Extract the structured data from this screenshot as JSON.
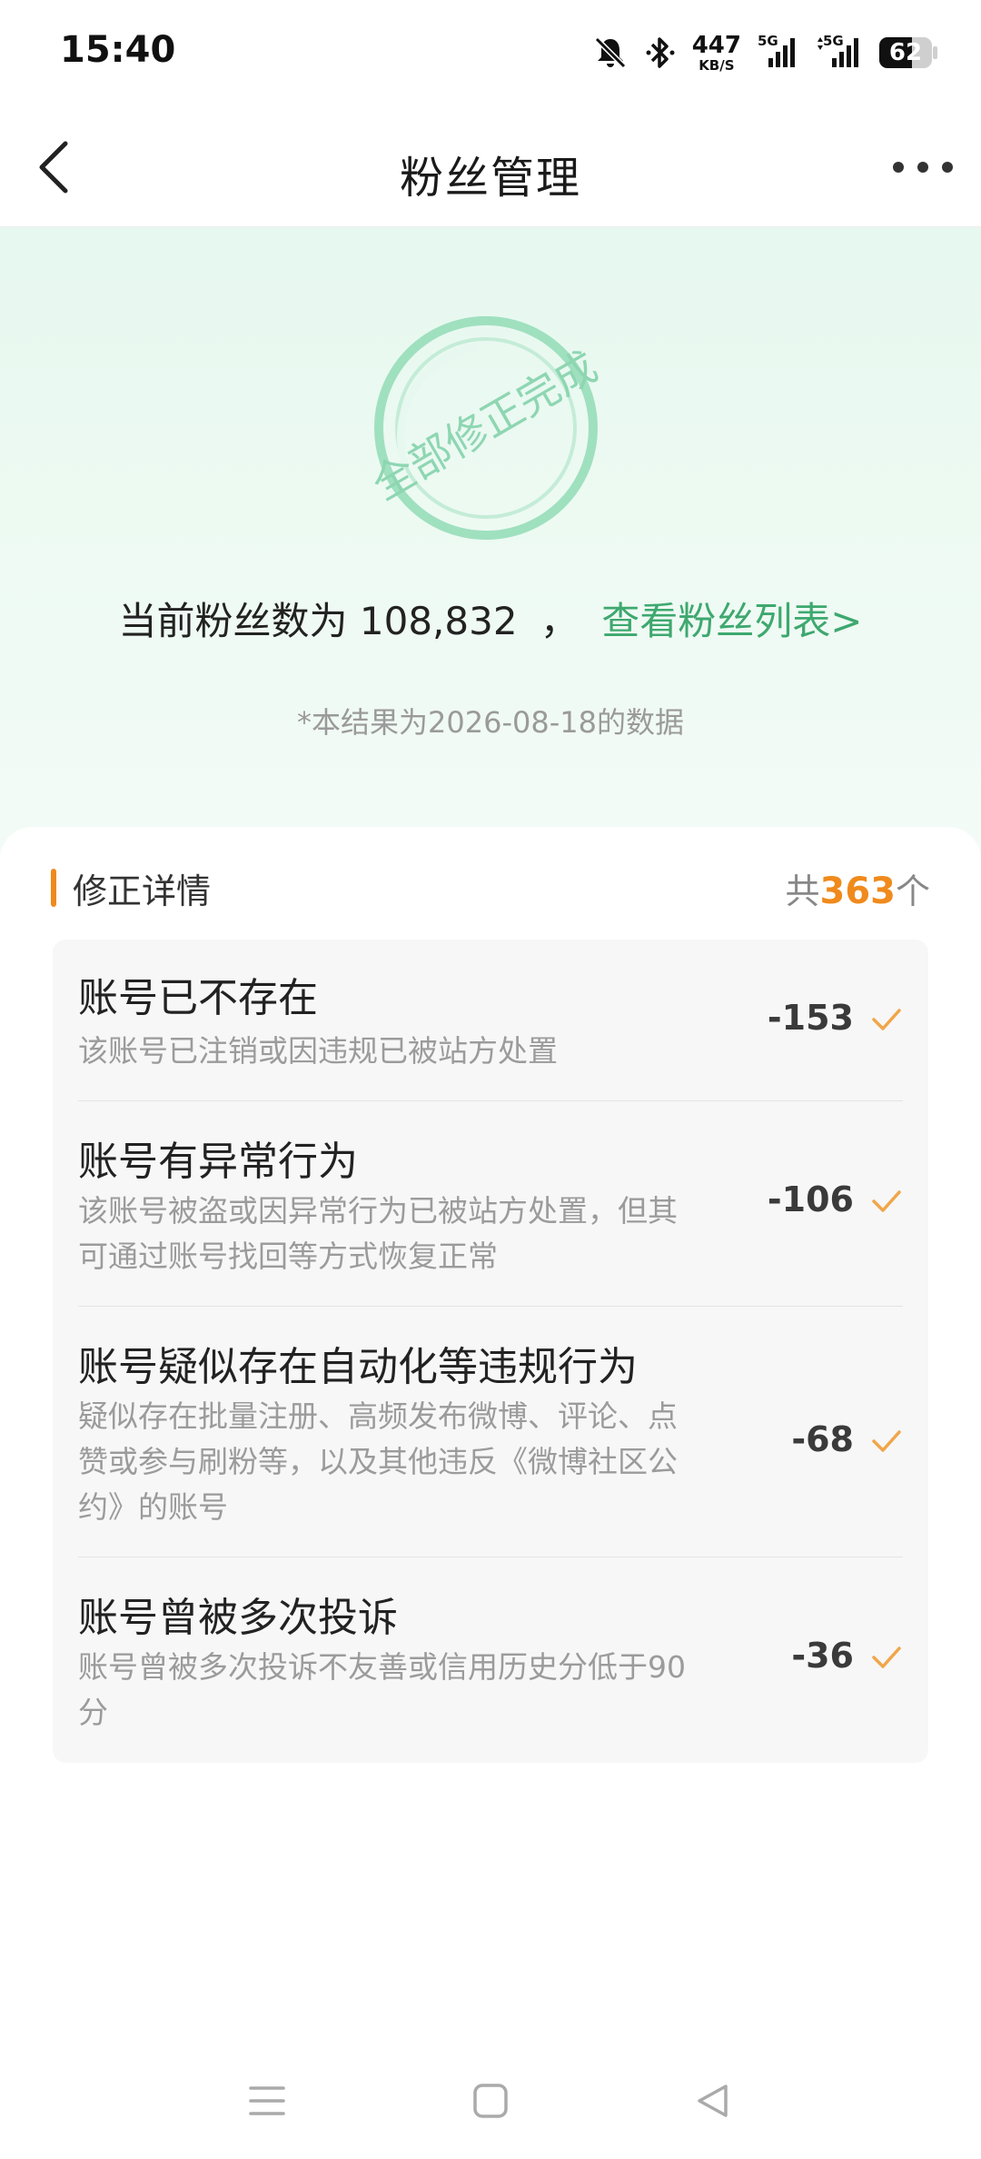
{
  "status_bar": {
    "time": "15:40",
    "net_speed": "447",
    "net_unit": "KB/S",
    "signal1_label": "5G",
    "signal2_label": "5G",
    "battery_level": "62",
    "battery_fraction": 0.62,
    "icons": [
      "bell-mute-icon",
      "bluetooth-icon",
      "signal-icon",
      "signal-icon",
      "battery-icon"
    ]
  },
  "nav": {
    "title": "粉丝管理",
    "back_icon": "chevron-left-icon",
    "more_icon": "more-dots-icon"
  },
  "hero": {
    "stamp_text": "全部修正完成",
    "summary_prefix": "当前粉丝数为",
    "follower_count": "108,832",
    "separator": "，",
    "link_text": "查看粉丝列表>",
    "note": "*本结果为2026-08-18的数据",
    "accent": "#3ea86f"
  },
  "details": {
    "title": "修正详情",
    "total_prefix": "共",
    "total_count": "363",
    "total_suffix": "个",
    "accent": "#f08a1c",
    "items": [
      {
        "title": "账号已不存在",
        "desc_lines": [
          "该账号已注销或因违规已被站方处置"
        ],
        "value": "-153"
      },
      {
        "title": "账号有异常行为",
        "desc_lines": [
          "该账号被盗或因异常行为已被站方处置，但其",
          "可通过账号找回等方式恢复正常"
        ],
        "value": "-106"
      },
      {
        "title": "账号疑似存在自动化等违规行为",
        "desc_lines": [
          "疑似存在批量注册、高频发布微博、评论、点",
          "赞或参与刷粉等，以及其他违反《微博社区公",
          "约》的账号"
        ],
        "value": "-68"
      },
      {
        "title": "账号曾被多次投诉",
        "desc_lines": [
          "账号曾被多次投诉不友善或信用历史分低于90",
          "分"
        ],
        "value": "-36"
      }
    ]
  },
  "system_nav": {
    "icons": [
      "menu-icon",
      "home-square-icon",
      "back-triangle-icon"
    ]
  }
}
